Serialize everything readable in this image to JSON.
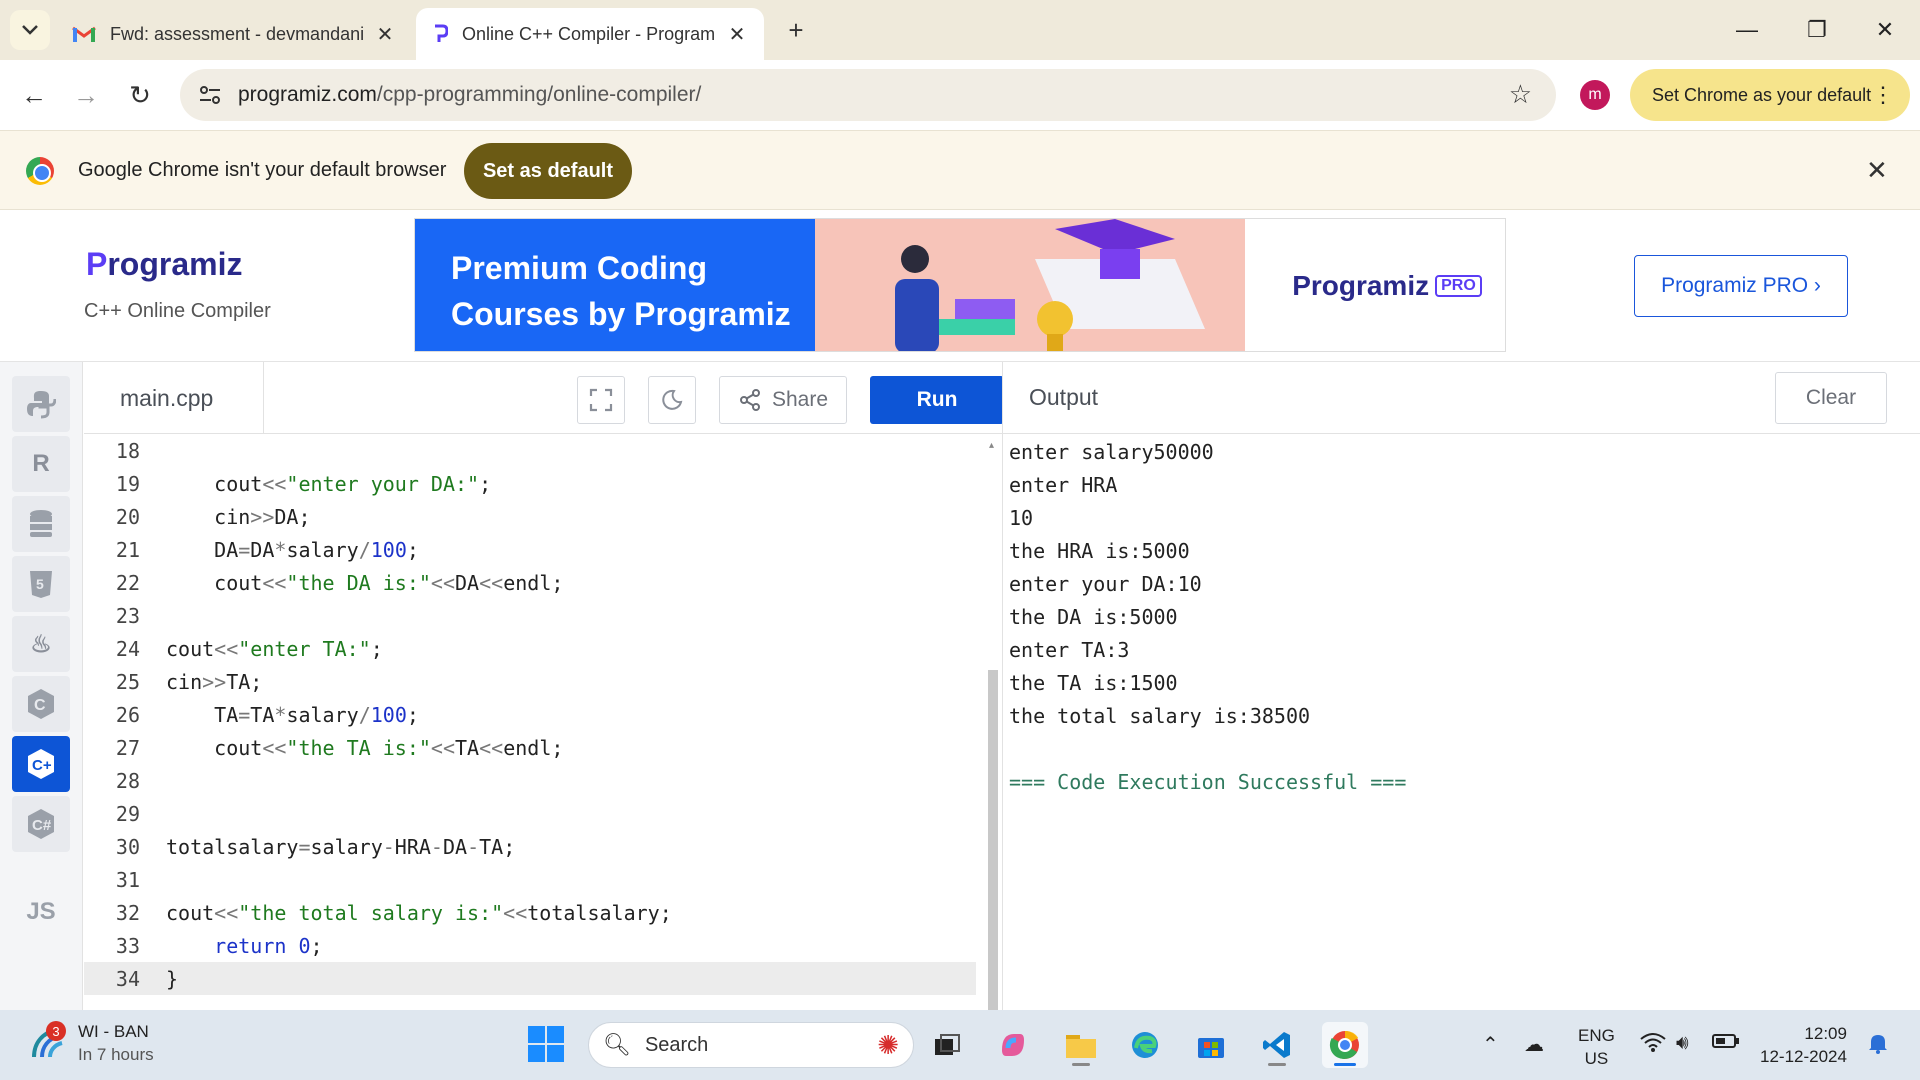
{
  "browser": {
    "tabs": [
      {
        "title": "Fwd: assessment - devmandani",
        "icon": "gmail-icon"
      },
      {
        "title": "Online C++ Compiler - Program",
        "icon": "programiz-icon"
      }
    ],
    "url_domain": "programiz.com",
    "url_path": "/cpp-programming/online-compiler/",
    "profile_initial": "m",
    "set_default_chip": "Set Chrome as your default",
    "infobar_message": "Google Chrome isn't your default browser",
    "infobar_button": "Set as default"
  },
  "site": {
    "logo_text_first": "P",
    "logo_text_rest": "rogramiz",
    "logo_subtitle": "C++ Online Compiler",
    "banner_line1": "Premium Coding",
    "banner_line2": "Courses by Programiz",
    "banner_brand": "Programiz",
    "banner_pro": "PRO",
    "pro_button": "Programiz PRO ›"
  },
  "lang_rail": [
    {
      "name": "python-icon",
      "glyph": "⛭"
    },
    {
      "name": "r-icon",
      "glyph": "R"
    },
    {
      "name": "sql-icon",
      "glyph": "≣"
    },
    {
      "name": "html-icon",
      "glyph": "5"
    },
    {
      "name": "java-icon",
      "glyph": "♨"
    },
    {
      "name": "c-icon",
      "glyph": "C"
    },
    {
      "name": "cpp-icon",
      "glyph": "C"
    },
    {
      "name": "csharp-icon",
      "glyph": "C"
    },
    {
      "name": "js-icon",
      "glyph": "JS"
    }
  ],
  "editor": {
    "filename": "main.cpp",
    "share_label": "Share",
    "run_label": "Run",
    "lines": [
      {
        "n": "18",
        "code": ""
      },
      {
        "n": "19",
        "code": "    cout<<\"enter your DA:\";"
      },
      {
        "n": "20",
        "code": "    cin>>DA;"
      },
      {
        "n": "21",
        "code": "    DA=DA*salary/100;"
      },
      {
        "n": "22",
        "code": "    cout<<\"the DA is:\"<<DA<<endl;"
      },
      {
        "n": "23",
        "code": ""
      },
      {
        "n": "24",
        "code": "cout<<\"enter TA:\";"
      },
      {
        "n": "25",
        "code": "cin>>TA;"
      },
      {
        "n": "26",
        "code": "    TA=TA*salary/100;"
      },
      {
        "n": "27",
        "code": "    cout<<\"the TA is:\"<<TA<<endl;"
      },
      {
        "n": "28",
        "code": ""
      },
      {
        "n": "29",
        "code": ""
      },
      {
        "n": "30",
        "code": "totalsalary=salary-HRA-DA-TA;"
      },
      {
        "n": "31",
        "code": ""
      },
      {
        "n": "32",
        "code": "cout<<\"the total salary is:\"<<totalsalary;"
      },
      {
        "n": "33",
        "code": "    return 0;"
      },
      {
        "n": "34",
        "code": "}"
      }
    ],
    "current_line": "34"
  },
  "output": {
    "title": "Output",
    "clear_label": "Clear",
    "lines": [
      "enter salary50000",
      "enter HRA",
      "10",
      "the HRA is:5000",
      "enter your DA:10",
      "the DA is:5000",
      "enter TA:3",
      "the TA is:1500",
      "the total salary is:38500",
      "",
      "=== Code Execution Successful ==="
    ]
  },
  "taskbar": {
    "weather_badge": "3",
    "weather_title": "WI - BAN",
    "weather_sub": "In 7 hours",
    "search_placeholder": "Search",
    "lang_line1": "ENG",
    "lang_line2": "US",
    "time": "12:09",
    "date": "12-12-2024"
  },
  "colors": {
    "accent": "#0d55d6",
    "success_text": "#2f7a5e",
    "string_token": "#1f7a1f",
    "number_token": "#1c33c9"
  }
}
